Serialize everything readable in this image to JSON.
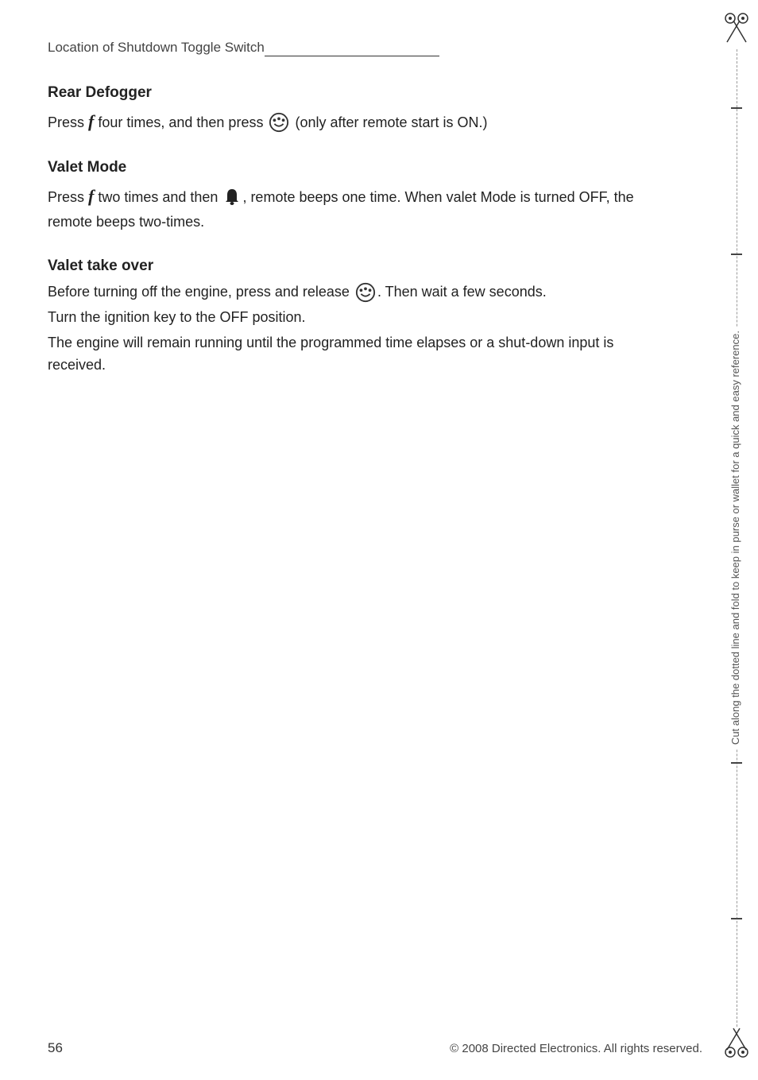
{
  "page": {
    "number": "56",
    "copyright": "© 2008 Directed Electronics.  All rights reserved."
  },
  "location_line": {
    "text": "Location of Shutdown Toggle Switch",
    "underline_length": "220px"
  },
  "sections": [
    {
      "id": "rear-defogger",
      "title": "Rear Defogger",
      "body_parts": [
        "Press ",
        "f_icon",
        " four times, and then press ",
        "remote_icon",
        " (only after remote start is ON.)"
      ],
      "body_text": "Press  four times, and then press  (only after remote start is ON.)"
    },
    {
      "id": "valet-mode",
      "title": "Valet Mode",
      "body_text": "Press  two times and then  , remote beeps one time. When valet Mode is turned OFF, the remote beeps two-times."
    },
    {
      "id": "valet-takeover",
      "title": "Valet take over",
      "body_lines": [
        "Before turning off the engine, press and release  .  Then wait a few seconds.",
        "Turn the ignition key to the OFF position.",
        "The engine will remain running until the programmed time elapses or a shut-down input is received."
      ]
    }
  ],
  "cut_line": {
    "vertical_text": "Cut along the dotted line and fold to keep in purse or wallet for a quick and easy reference."
  },
  "icons": {
    "scissors": "✂",
    "f_key": "f",
    "bell": "🔔",
    "remote": "remote-circle"
  }
}
